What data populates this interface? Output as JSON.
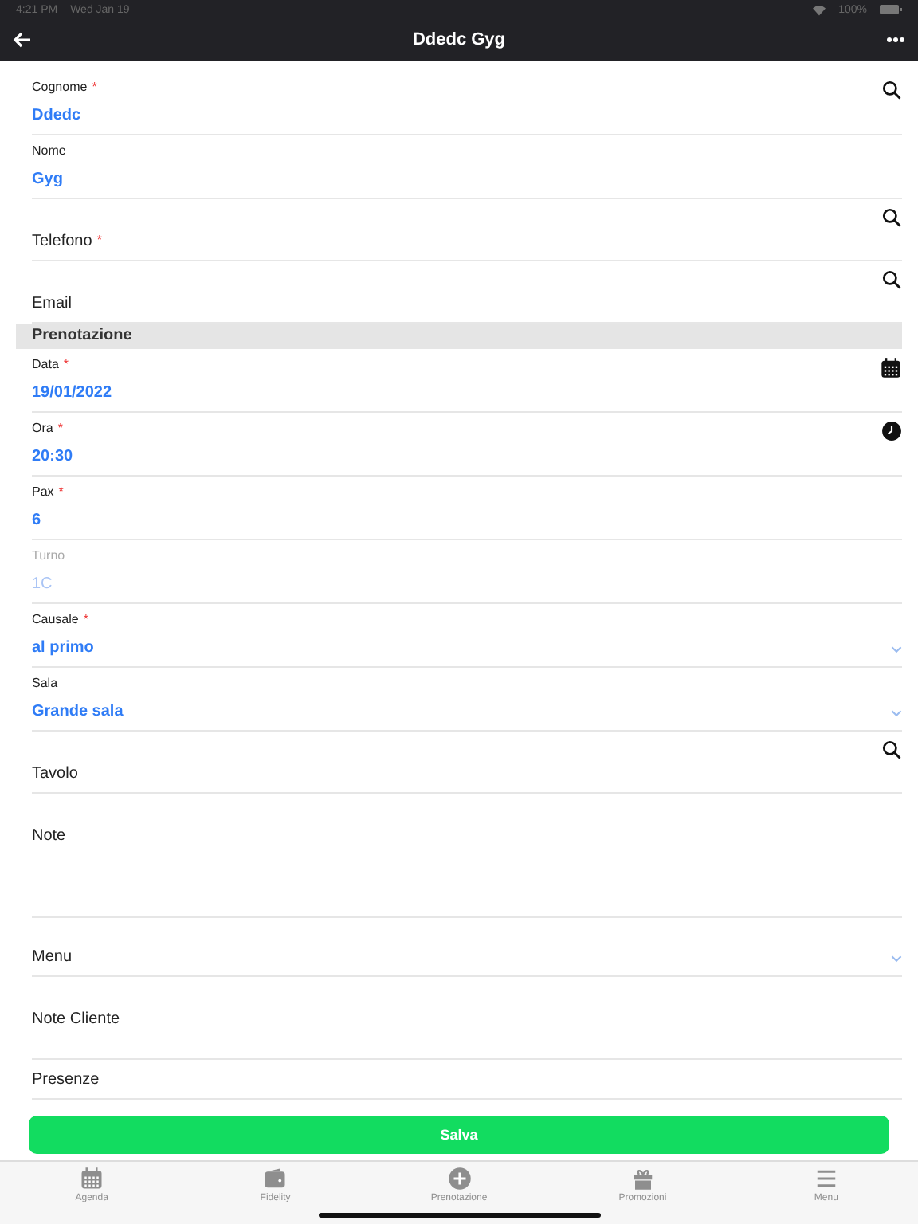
{
  "status_bar": {
    "time": "4:21 PM",
    "date": "Wed Jan 19",
    "battery": "100%"
  },
  "nav_bar": {
    "title": "Ddedc Gyg"
  },
  "form": [
    {
      "kind": "search",
      "label": "Cognome",
      "required_mark": "*",
      "value": "Ddedc",
      "disabled": false
    },
    {
      "kind": "text",
      "label": "Nome",
      "value": "Gyg",
      "disabled": false
    },
    {
      "kind": "search",
      "label": "Telefono",
      "required_mark": "*",
      "disabled": false
    },
    {
      "kind": "search",
      "label": "Email",
      "disabled": false
    },
    {
      "kind": "section",
      "label": "Prenotazione"
    },
    {
      "kind": "date",
      "label": "Data",
      "required_mark": "*",
      "value": "19/01/2022",
      "disabled": false
    },
    {
      "kind": "time",
      "label": "Ora",
      "required_mark": "*",
      "value": "20:30",
      "disabled": false
    },
    {
      "kind": "text",
      "label": "Pax",
      "required_mark": "*",
      "value": "6",
      "disabled": false
    },
    {
      "kind": "text",
      "label": "Turno",
      "value": "1C",
      "disabled": true
    },
    {
      "kind": "select",
      "label": "Causale",
      "required_mark": "*",
      "value": "al primo",
      "disabled": false
    },
    {
      "kind": "select",
      "label": "Sala",
      "value": "Grande sala",
      "disabled": false
    },
    {
      "kind": "search",
      "label": "Tavolo",
      "disabled": false
    },
    {
      "kind": "textarea",
      "label": "Note"
    },
    {
      "kind": "select",
      "label": "Menu",
      "disabled": false
    },
    {
      "kind": "note",
      "label": "Note Cliente"
    },
    {
      "kind": "plain",
      "label": "Presenze"
    }
  ],
  "save_button": "Salva",
  "tab_bar": [
    {
      "label": "Agenda",
      "selected": false
    },
    {
      "label": "Fidelity",
      "selected": false
    },
    {
      "label": "Prenotazione",
      "selected": false
    },
    {
      "label": "Promozioni",
      "selected": false
    },
    {
      "label": "Menu",
      "selected": false
    }
  ]
}
